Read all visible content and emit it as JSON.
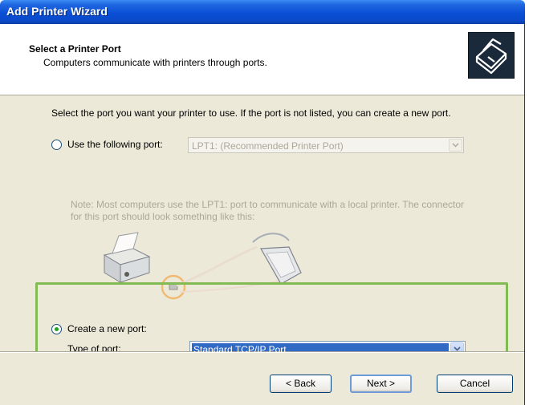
{
  "window": {
    "title": "Add Printer Wizard"
  },
  "header": {
    "title": "Select a Printer Port",
    "subtitle": "Computers communicate with printers through ports.",
    "icon": "printer-port-icon"
  },
  "body": {
    "intro": "Select the port you want your printer to use.  If the port is not listed, you can create a new port.",
    "use_existing": {
      "label": "Use the following port:",
      "selected": false,
      "port_value": "LPT1: (Recommended Printer Port)"
    },
    "note": "Note: Most computers use the LPT1: port to communicate with a local printer. The connector for this port should look something like this:",
    "create_new": {
      "label": "Create a new port:",
      "selected": true,
      "type_label": "Type of port:",
      "type_value": "Standard TCP/IP Port"
    }
  },
  "footer": {
    "back_label": "< Back",
    "next_label": "Next >",
    "cancel_label": "Cancel"
  },
  "colors": {
    "title_bar": "#0a4fd6",
    "highlight_box": "#82bb53",
    "selection": "#316ac5"
  }
}
